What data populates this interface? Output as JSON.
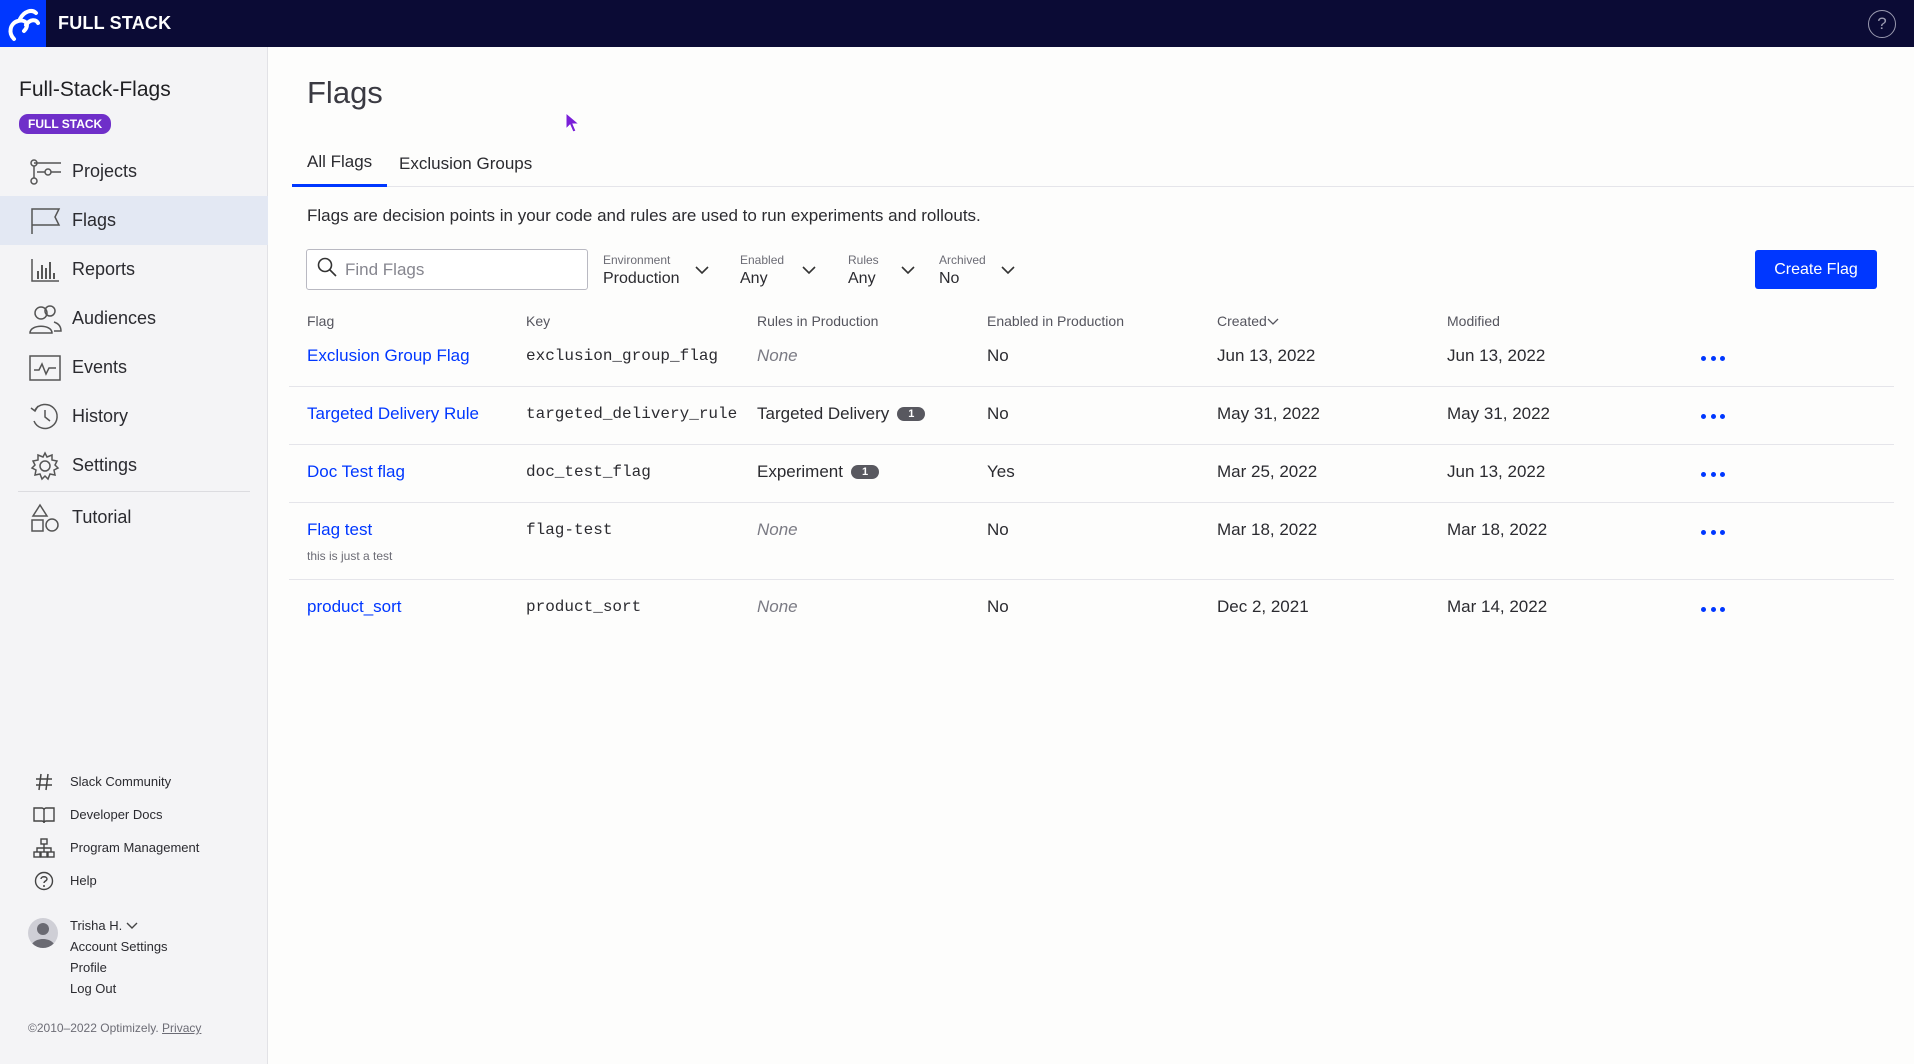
{
  "topbar": {
    "brand": "FULL STACK",
    "help_icon": "question-circle-icon",
    "help_glyph": "?"
  },
  "sidebar": {
    "project_name": "Full-Stack-Flags",
    "project_badge": "FULL STACK",
    "nav": [
      {
        "label": "Projects",
        "icon": "projects-icon",
        "active": false
      },
      {
        "label": "Flags",
        "icon": "flag-icon",
        "active": true
      },
      {
        "label": "Reports",
        "icon": "reports-icon",
        "active": false
      },
      {
        "label": "Audiences",
        "icon": "audiences-icon",
        "active": false
      },
      {
        "label": "Events",
        "icon": "events-icon",
        "active": false
      },
      {
        "label": "History",
        "icon": "history-icon",
        "active": false
      },
      {
        "label": "Settings",
        "icon": "settings-icon",
        "active": false
      },
      {
        "label": "Tutorial",
        "icon": "tutorial-icon",
        "active": false
      }
    ],
    "links": [
      {
        "label": "Slack Community",
        "icon": "hash-icon"
      },
      {
        "label": "Developer Docs",
        "icon": "book-icon"
      },
      {
        "label": "Program Management",
        "icon": "org-chart-icon"
      },
      {
        "label": "Help",
        "icon": "help-icon"
      }
    ],
    "user": {
      "name": "Trisha H.",
      "account_settings": "Account Settings",
      "profile": "Profile",
      "logout": "Log Out"
    },
    "copyright": "©2010–2022 Optimizely.",
    "privacy": "Privacy"
  },
  "main": {
    "title": "Flags",
    "tabs": [
      {
        "label": "All Flags",
        "active": true
      },
      {
        "label": "Exclusion Groups",
        "active": false
      }
    ],
    "description": "Flags are decision points in your code and rules are used to run experiments and rollouts.",
    "search_placeholder": "Find Flags",
    "filters": [
      {
        "label": "Environment",
        "value": "Production"
      },
      {
        "label": "Enabled",
        "value": "Any"
      },
      {
        "label": "Rules",
        "value": "Any"
      },
      {
        "label": "Archived",
        "value": "No"
      }
    ],
    "create_button": "Create Flag",
    "columns": [
      "Flag",
      "Key",
      "Rules in Production",
      "Enabled in Production",
      "Created",
      "Modified"
    ],
    "rows": [
      {
        "flag": "Exclusion Group Flag",
        "desc": "",
        "key": "exclusion_group_flag",
        "rules": "None",
        "rules_count": "",
        "enabled": "No",
        "created": "Jun 13, 2022",
        "modified": "Jun 13, 2022"
      },
      {
        "flag": "Targeted Delivery Rule",
        "desc": "",
        "key": "targeted_delivery_rule",
        "rules": "Targeted Delivery",
        "rules_count": "1",
        "enabled": "No",
        "created": "May 31, 2022",
        "modified": "May 31, 2022"
      },
      {
        "flag": "Doc Test flag",
        "desc": "",
        "key": "doc_test_flag",
        "rules": "Experiment",
        "rules_count": "1",
        "enabled": "Yes",
        "created": "Mar 25, 2022",
        "modified": "Jun 13, 2022"
      },
      {
        "flag": "Flag test",
        "desc": "this is just a test",
        "key": "flag-test",
        "rules": "None",
        "rules_count": "",
        "enabled": "No",
        "created": "Mar 18, 2022",
        "modified": "Mar 18, 2022"
      },
      {
        "flag": "product_sort",
        "desc": "",
        "key": "product_sort",
        "rules": "None",
        "rules_count": "",
        "enabled": "No",
        "created": "Dec 2, 2021",
        "modified": "Mar 14, 2022"
      }
    ]
  },
  "colors": {
    "accent": "#0037ff",
    "topbar": "#0b0b35",
    "badge": "#6f2fc9"
  }
}
